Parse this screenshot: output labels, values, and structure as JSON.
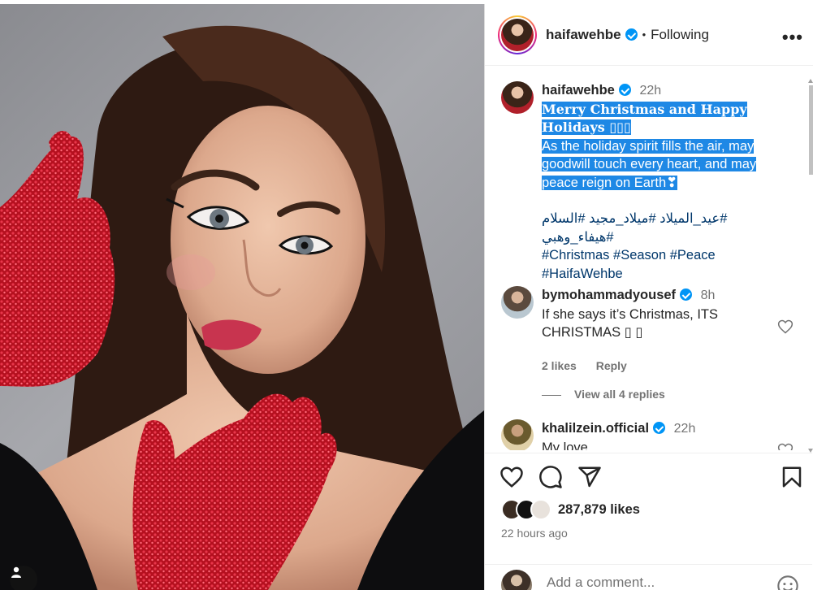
{
  "post": {
    "author": "haifawehbe",
    "follow_state": "Following",
    "more_label": "•••"
  },
  "caption": {
    "username": "haifawehbe",
    "time": "22h",
    "title_line1": "Merry Christmas and Happy",
    "title_line2": "Holidays ▯▯▯",
    "body_line1": "As the holiday spirit fills the air, may",
    "body_line2": "goodwill touch every heart, and may",
    "body_line3": "peace reign on Earth❣",
    "tags_line1": "#عيد_الميلاد #ميلاد_مجيد #السلام #هيفاء_وهبي",
    "tags_line2": "#Christmas #Season #Peace",
    "tags_line3": "#HaifaWehbe"
  },
  "comments": [
    {
      "username": "bymohammadyousef",
      "time": "8h",
      "text_line1": "If she says it’s Christmas, ITS",
      "text_line2": "CHRISTMAS ▯ ▯",
      "likes": "2 likes",
      "reply": "Reply",
      "view_replies": "View all 4 replies"
    },
    {
      "username": "khalilzein.official",
      "time": "22h",
      "text_line1": "My love"
    }
  ],
  "stats": {
    "likes": "287,879 likes",
    "posted": "22 hours ago"
  },
  "composer": {
    "placeholder": "Add a comment..."
  },
  "icons": [
    "heart-icon",
    "comment-icon",
    "share-icon",
    "bookmark-icon",
    "more-icon",
    "verified-icon",
    "emoji-icon",
    "user-tag-icon"
  ],
  "colors": {
    "accent": "#0095f6",
    "selection": "#1e88e5",
    "hashtag": "#00376b",
    "muted": "#737373",
    "glove": "#c4182a"
  }
}
